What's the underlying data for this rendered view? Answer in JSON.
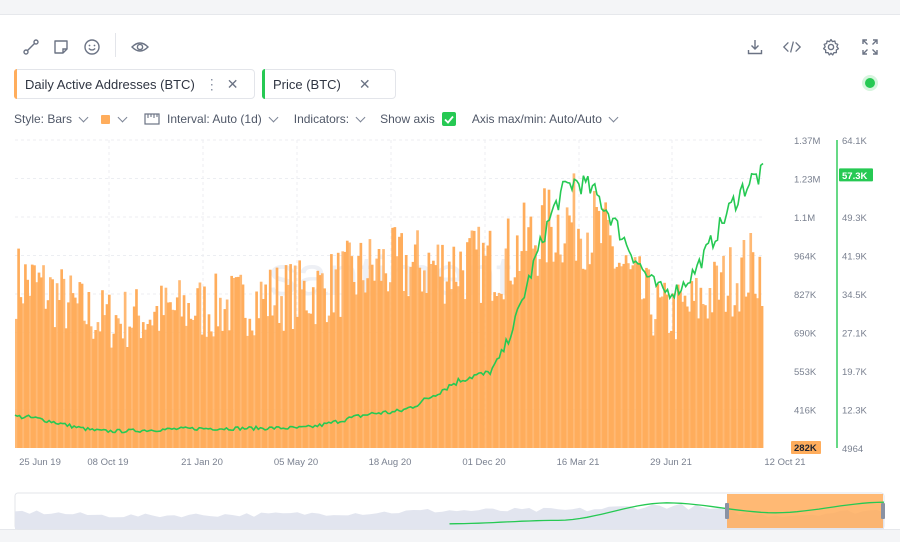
{
  "toolbar": {
    "left_icons": [
      "line-tool-icon",
      "note-icon",
      "emoji-icon",
      "eye-icon"
    ],
    "right_icons": [
      "download-icon",
      "embed-code-icon",
      "settings-icon",
      "fullscreen-icon"
    ]
  },
  "metrics": [
    {
      "label": "Daily Active Addresses (BTC)",
      "color": "#ffad5c"
    },
    {
      "label": "Price (BTC)",
      "color": "#26c953"
    }
  ],
  "settings": {
    "style": "Style: Bars",
    "interval": "Interval: Auto (1d)",
    "indicators": "Indicators:",
    "show_axis": "Show axis",
    "axis_minmax": "Axis max/min: Auto/Auto"
  },
  "watermark": "santiment",
  "chart_data": {
    "type": "bar",
    "x_ticks": [
      "25 Jun 19",
      "08 Oct 19",
      "21 Jan 20",
      "05 May 20",
      "18 Aug 20",
      "01 Dec 20",
      "16 Mar 21",
      "29 Jun 21",
      "12 Oct 21"
    ],
    "y_left_ticks": [
      "1.37M",
      "1.23M",
      "1.1M",
      "964K",
      "827K",
      "690K",
      "553K",
      "416K",
      "282K"
    ],
    "y_right_ticks": [
      "64.1K",
      "57.3K",
      "49.3K",
      "41.9K",
      "34.5K",
      "27.1K",
      "19.7K",
      "12.3K",
      "4964"
    ],
    "y_left_range": [
      282000,
      1370000
    ],
    "y_right_range": [
      4964,
      64100
    ],
    "left_current_label": "282K",
    "right_current_label": "57.3K",
    "series": [
      {
        "name": "Daily Active Addresses (BTC)",
        "axis": "left",
        "color": "#ffad5c",
        "points": [
          [
            "25 Jun 19",
            900000
          ],
          [
            "08 Oct 19",
            760000
          ],
          [
            "21 Jan 20",
            800000
          ],
          [
            "05 May 20",
            850000
          ],
          [
            "18 Aug 20",
            950000
          ],
          [
            "01 Dec 20",
            960000
          ],
          [
            "16 Mar 21",
            1120000
          ],
          [
            "29 Jun 21",
            780000
          ],
          [
            "12 Oct 21",
            950000
          ]
        ]
      },
      {
        "name": "Price (BTC)",
        "axis": "right",
        "color": "#26c953",
        "points": [
          [
            "25 Jun 19",
            11000
          ],
          [
            "08 Oct 19",
            8200
          ],
          [
            "21 Jan 20",
            8700
          ],
          [
            "05 May 20",
            8800
          ],
          [
            "18 Aug 20",
            11800
          ],
          [
            "01 Dec 20",
            19000
          ],
          [
            "16 Mar 21",
            56000
          ],
          [
            "29 Jun 21",
            35000
          ],
          [
            "12 Oct 21",
            57300
          ]
        ]
      }
    ],
    "grid": true
  }
}
